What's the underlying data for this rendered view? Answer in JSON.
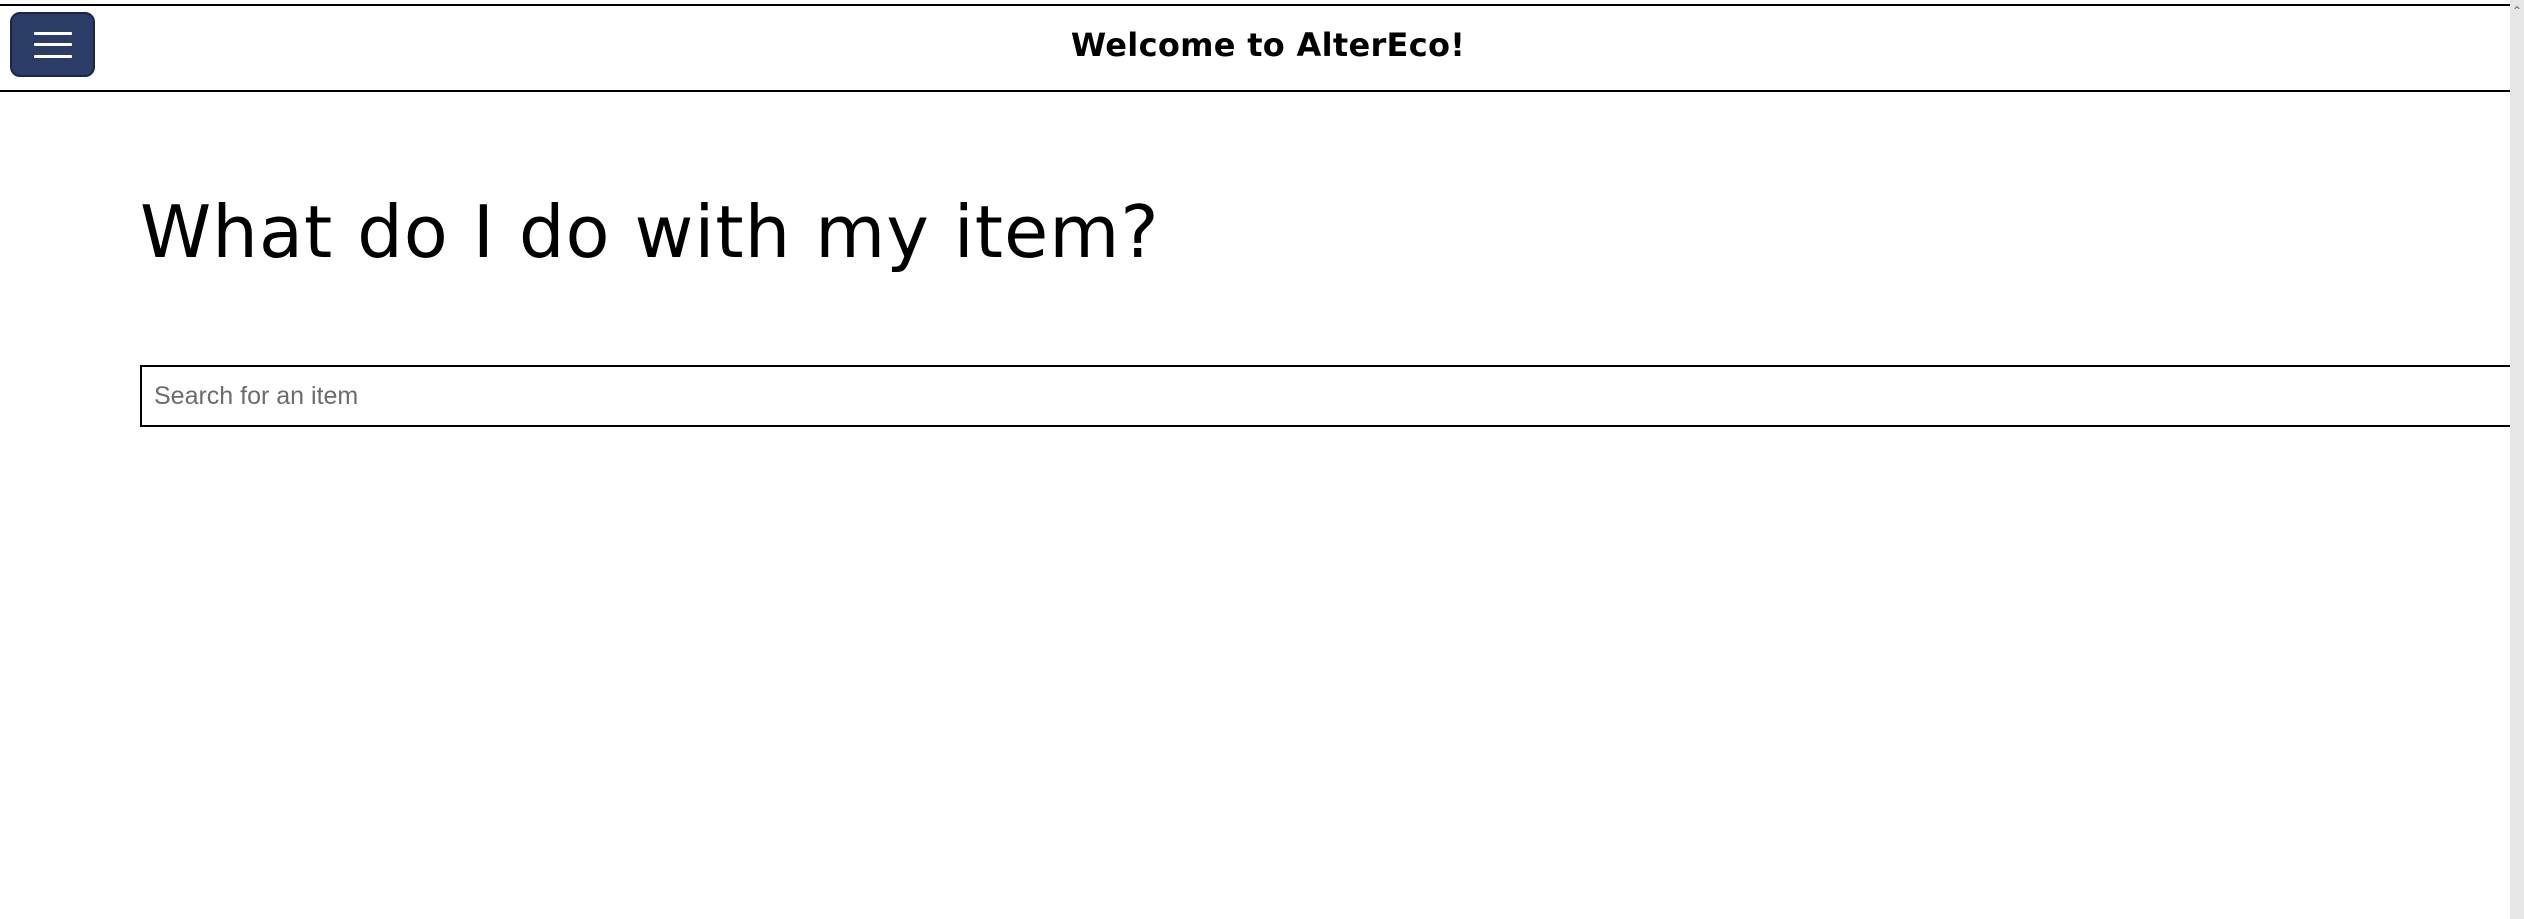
{
  "header": {
    "title": "Welcome to AlterEco!",
    "menu_icon": "hamburger-icon"
  },
  "main": {
    "heading": "What do I do with my item?",
    "search": {
      "placeholder": "Search for an item",
      "value": ""
    }
  },
  "colors": {
    "menu_button_bg": "#2b3d66",
    "text": "#000000",
    "background": "#ffffff"
  }
}
